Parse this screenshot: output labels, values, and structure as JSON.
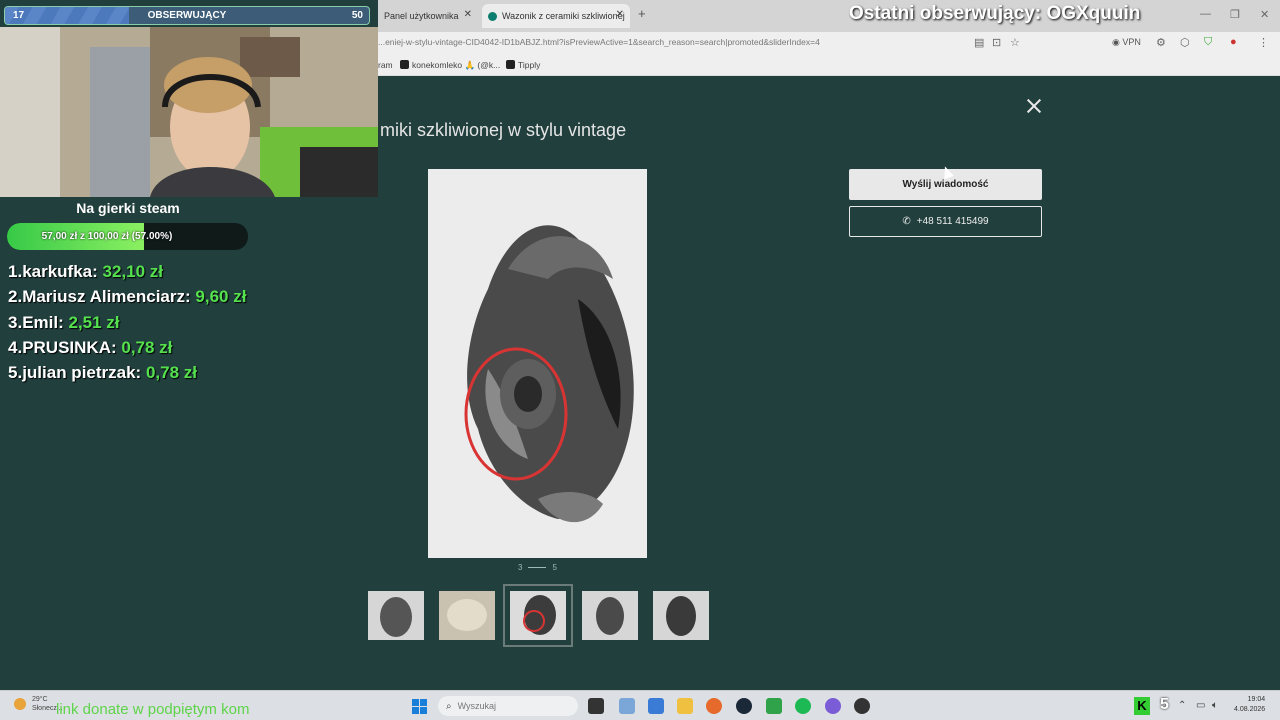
{
  "stream": {
    "followers_current": "17",
    "followers_goal": "50",
    "followers_label": "OBSERWUJĄCY",
    "followers_fraction": 0.34,
    "last_follower": "Ostatni obserwujący: OGXquuin",
    "goal": {
      "title": "Na gierki steam",
      "text": "57,00 zł z 100,00 zł (57.00%)",
      "fraction": 0.57
    },
    "donors": [
      {
        "rank": "1.",
        "name": "karkufka:",
        "amount": "32,10 zł"
      },
      {
        "rank": "2.",
        "name": "Mariusz Alimenciarz:",
        "amount": "9,60 zł"
      },
      {
        "rank": "3.",
        "name": "Emil:",
        "amount": "2,51 zł"
      },
      {
        "rank": "4.",
        "name": "PRUSINKA:",
        "amount": "0,78 zł"
      },
      {
        "rank": "5.",
        "name": "julian pietrzak:",
        "amount": "0,78 zł"
      }
    ],
    "link_note": "link donate w podpiętym kom"
  },
  "browser": {
    "tabs": [
      {
        "label": "Panel użytkownika"
      },
      {
        "label": "Wazonik z ceramiki szkliwionej"
      }
    ],
    "url": "...eniej-w-stylu-vintage-CID4042-ID1bABJZ.html?isPreviewActive=1&search_reason=search|promoted&sliderIndex=4",
    "vpn_label": "VPN",
    "bookmarks": [
      {
        "label": "ram"
      },
      {
        "label": "konekomleko 🙏 (@k..."
      },
      {
        "label": "Tipply"
      }
    ]
  },
  "listing": {
    "title": "miki szkliwionej w stylu vintage",
    "pager_current": "3",
    "pager_total": "5",
    "message_button": "Wyślij wiadomość",
    "phone_button": "+48 511 415499"
  },
  "taskbar": {
    "weather_temp": "29°C",
    "weather_desc": "Słonecz...",
    "search_placeholder": "Wyszukaj",
    "clock_time": "19:04",
    "clock_date": "4.08.2026",
    "tray_number": "5"
  },
  "colors": {
    "page_bg": "#213f3d",
    "goal_green": "#37c948",
    "donor_amount": "#55e14e",
    "follow_bar": "#5a86c8"
  }
}
